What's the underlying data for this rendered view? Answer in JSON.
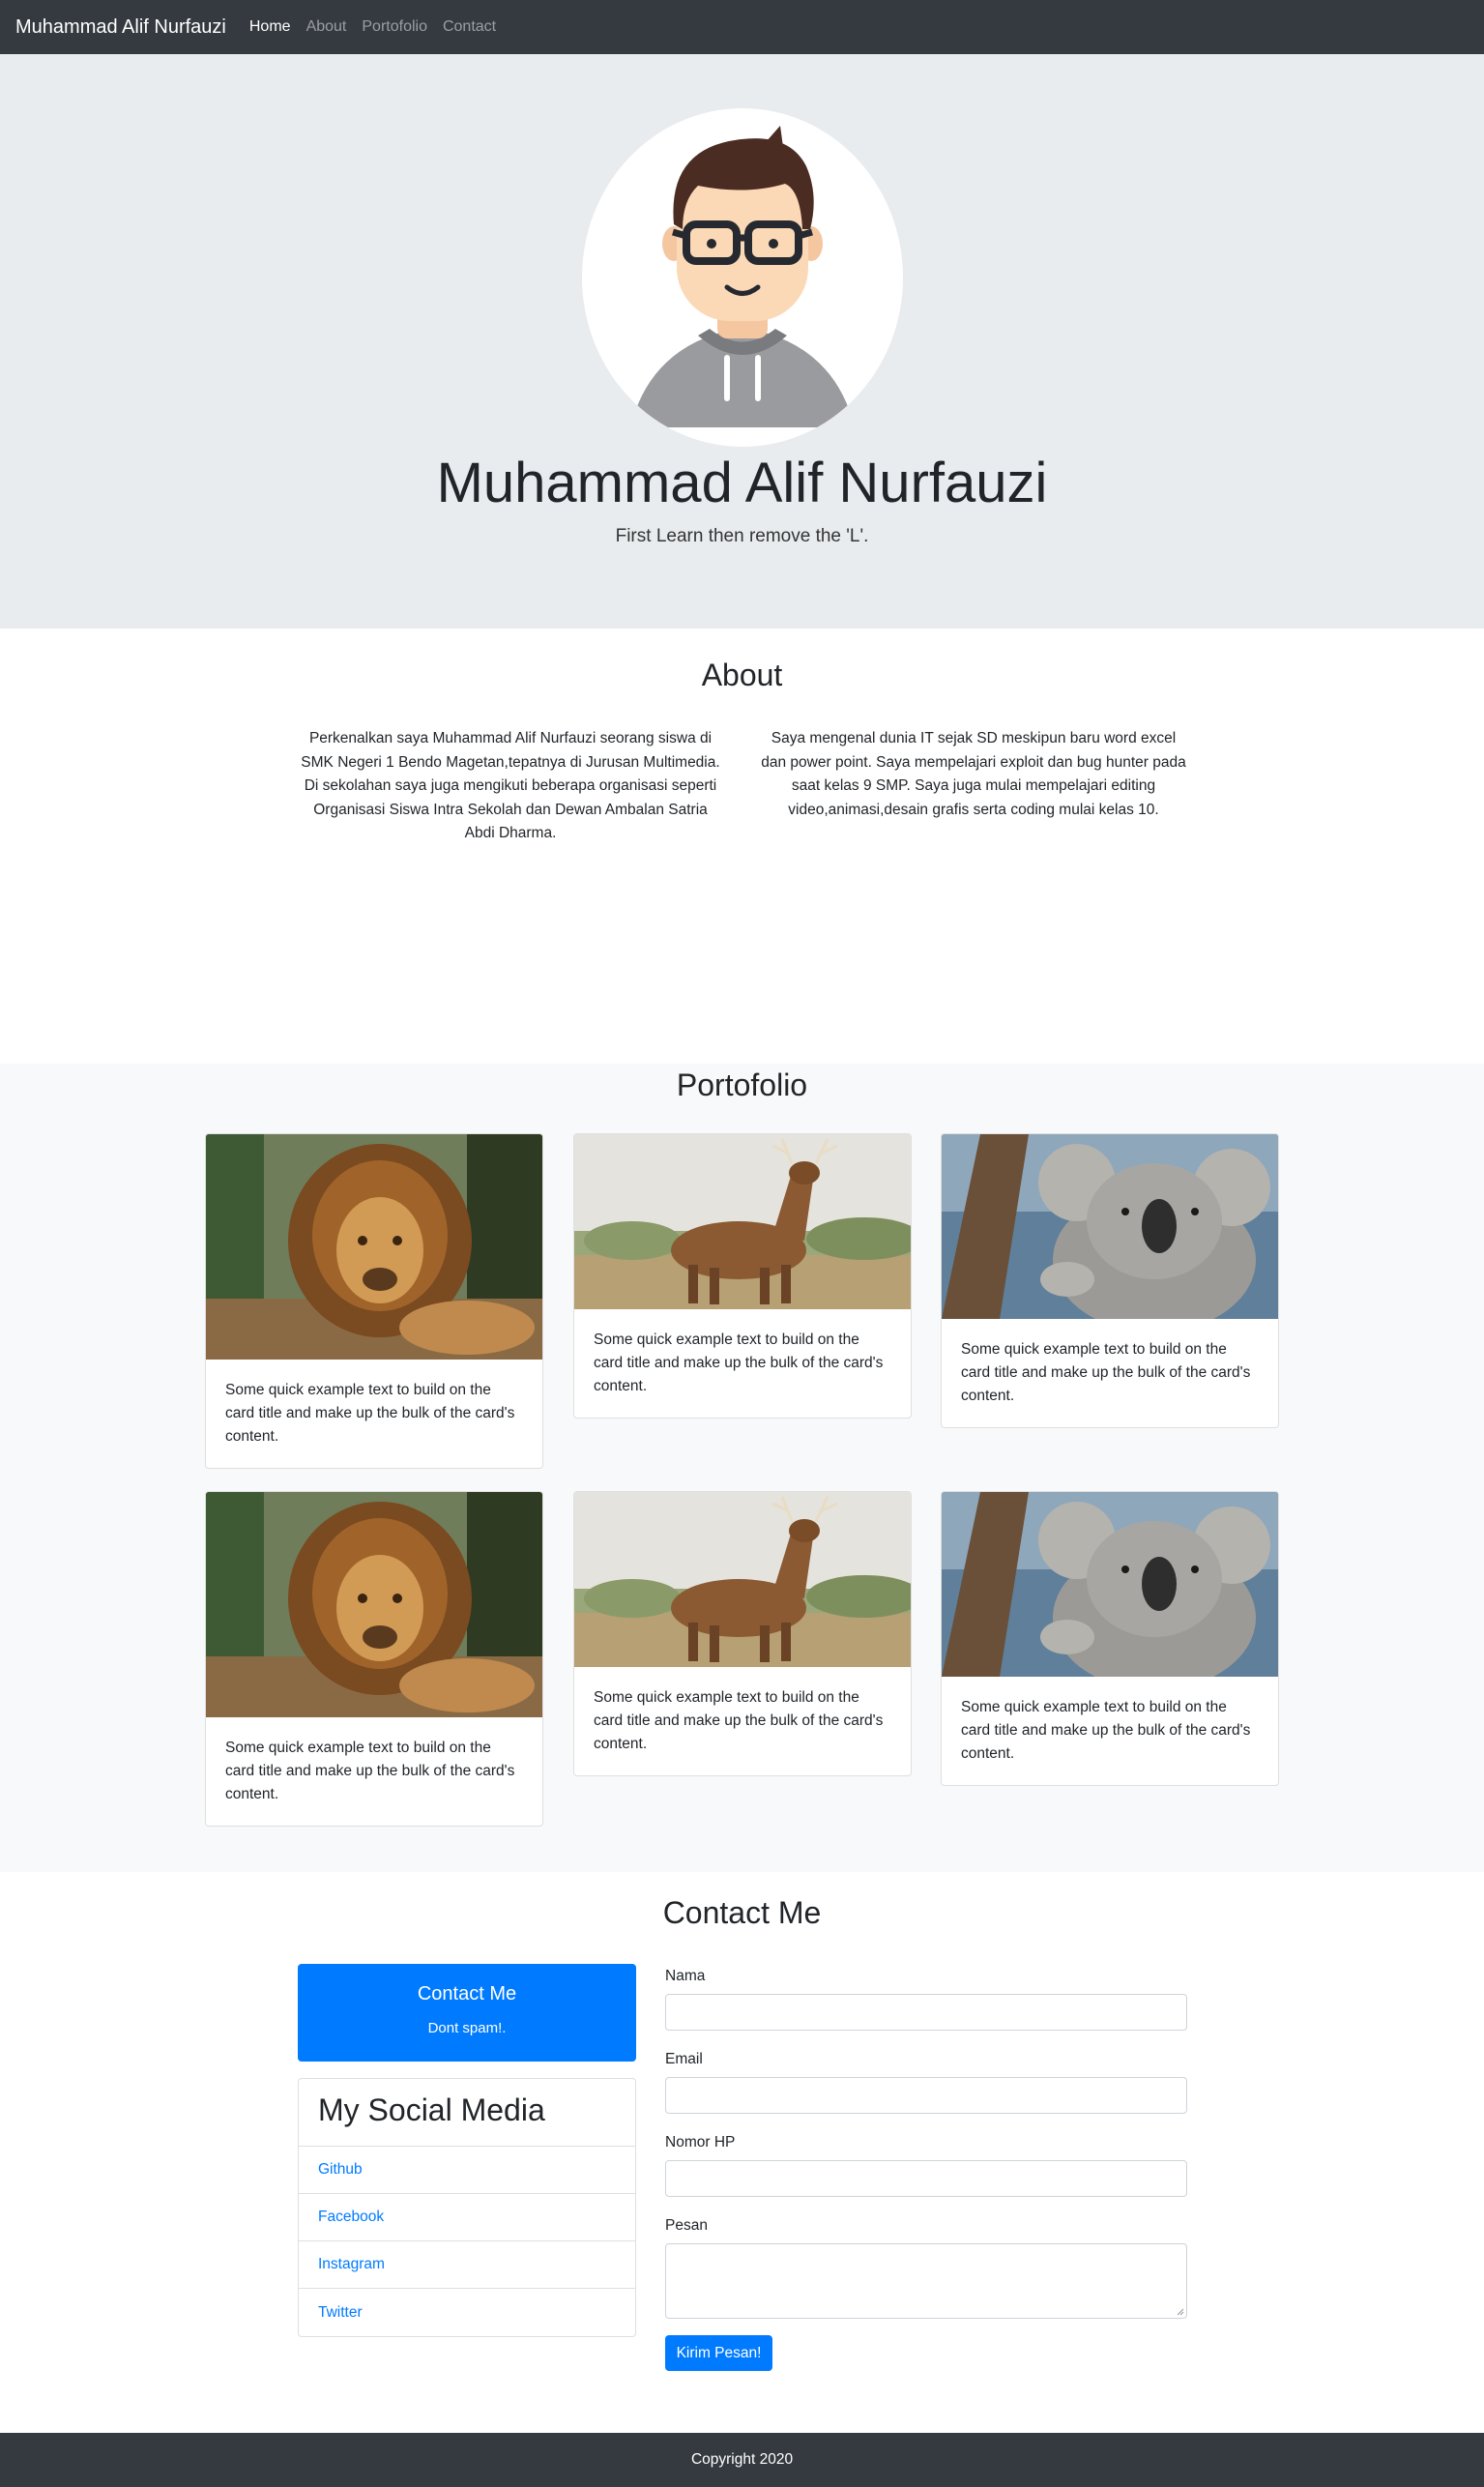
{
  "navbar": {
    "brand": "Muhammad Alif Nurfauzi",
    "links": [
      {
        "label": "Home",
        "active": true
      },
      {
        "label": "About",
        "active": false
      },
      {
        "label": "Portofolio",
        "active": false
      },
      {
        "label": "Contact",
        "active": false
      }
    ]
  },
  "hero": {
    "name": "Muhammad Alif Nurfauzi",
    "tagline": "First Learn then remove the 'L'.",
    "avatar_icon": "avatar-icon"
  },
  "about": {
    "title": "About",
    "left": "Perkenalkan saya Muhammad Alif Nurfauzi seorang siswa di SMK Negeri 1 Bendo Magetan,tepatnya di Jurusan Multimedia. Di sekolahan saya juga mengikuti beberapa organisasi seperti Organisasi Siswa Intra Sekolah dan Dewan Ambalan Satria Abdi Dharma.",
    "right": "Saya mengenal dunia IT sejak SD meskipun baru word excel dan power point. Saya mempelajari exploit dan bug hunter pada saat kelas 9 SMP. Saya juga mulai mempelajari editing video,animasi,desain grafis serta coding mulai kelas 10."
  },
  "portfolio": {
    "title": "Portofolio",
    "cards": [
      {
        "image": "lion",
        "text": "Some quick example text to build on the card title and make up the bulk of the card's content."
      },
      {
        "image": "deer",
        "text": "Some quick example text to build on the card title and make up the bulk of the card's content."
      },
      {
        "image": "koala",
        "text": "Some quick example text to build on the card title and make up the bulk of the card's content."
      },
      {
        "image": "lion",
        "text": "Some quick example text to build on the card title and make up the bulk of the card's content."
      },
      {
        "image": "deer",
        "text": "Some quick example text to build on the card title and make up the bulk of the card's content."
      },
      {
        "image": "koala",
        "text": "Some quick example text to build on the card title and make up the bulk of the card's content."
      }
    ]
  },
  "contact": {
    "title": "Contact Me",
    "box_title": "Contact Me",
    "box_subtitle": "Dont spam!.",
    "social_title": "My Social Media",
    "social_links": [
      "Github",
      "Facebook",
      "Instagram",
      "Twitter"
    ],
    "form": {
      "name_label": "Nama",
      "name_value": "",
      "email_label": "Email",
      "email_value": "",
      "phone_label": "Nomor HP",
      "phone_value": "",
      "message_label": "Pesan",
      "message_value": "",
      "submit_label": "Kirim Pesan!"
    }
  },
  "footer": {
    "text": "Copyright 2020"
  },
  "colors": {
    "navbar": "#343a40",
    "primary": "#007bff",
    "jumbotron": "#e9ecef",
    "section_light": "#f8f9fa"
  }
}
